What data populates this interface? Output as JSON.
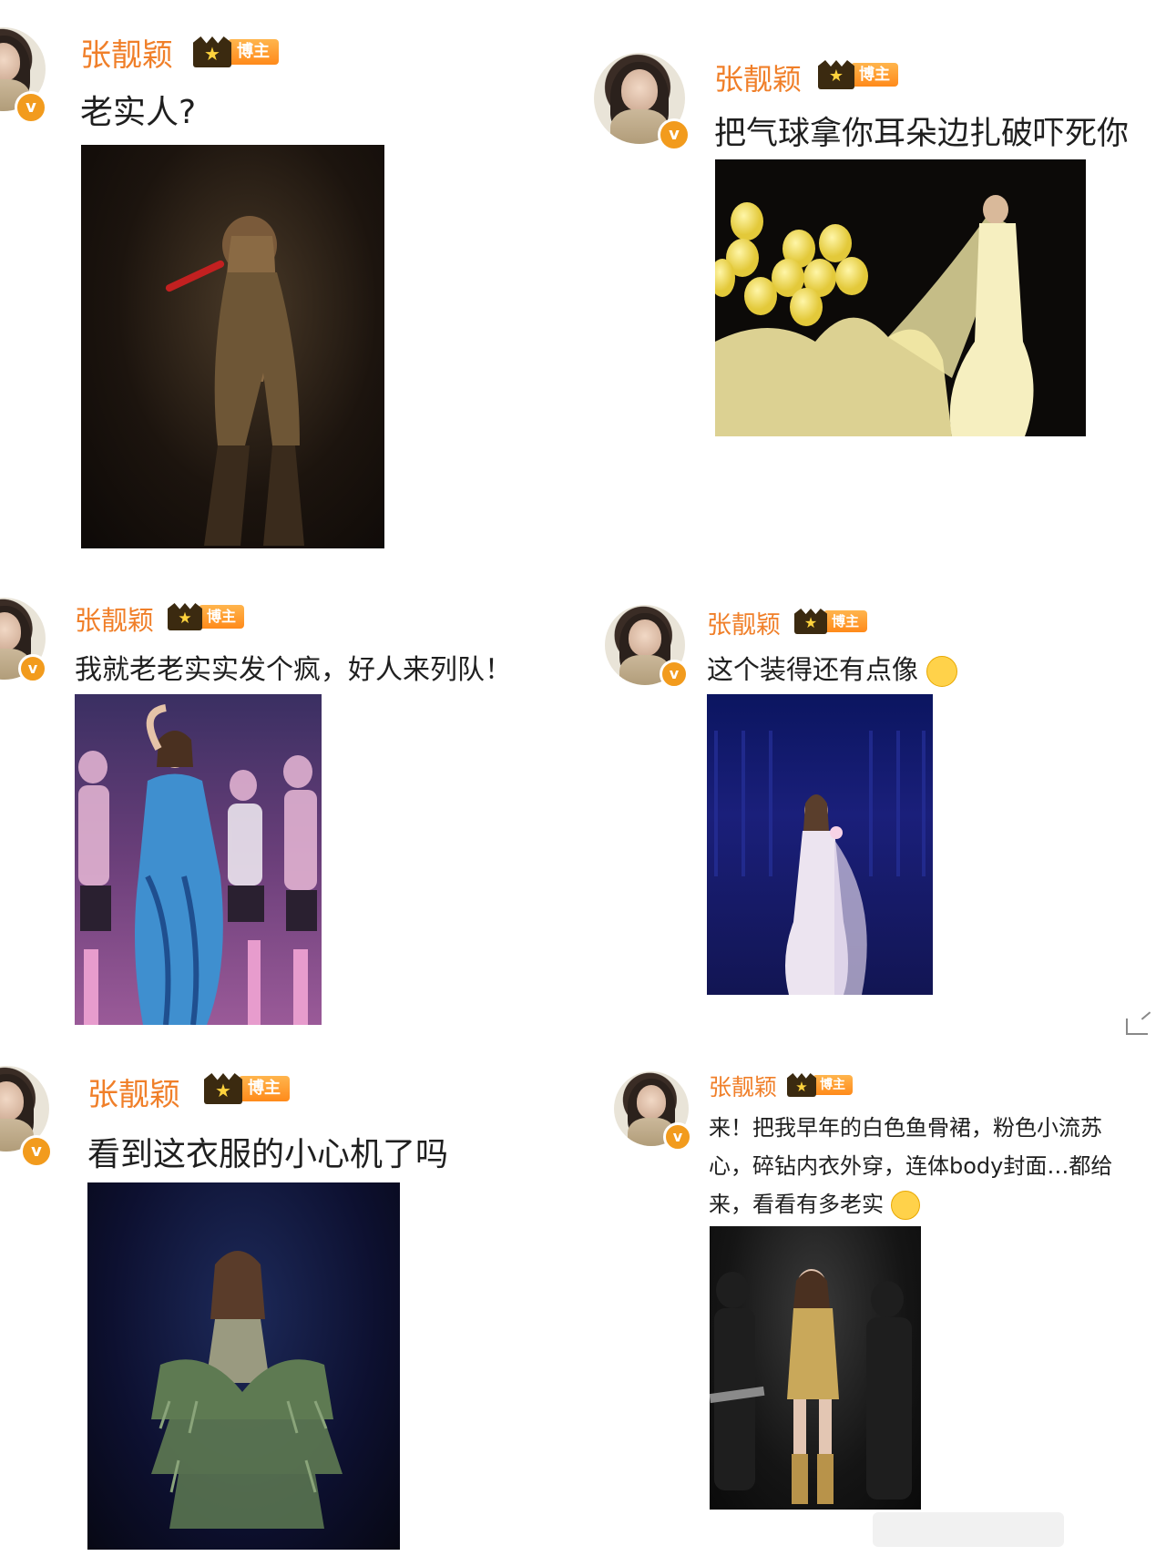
{
  "posts": [
    {
      "author": "张靓颖",
      "badge": "博主",
      "text": "老实人?"
    },
    {
      "author": "张靓颖",
      "badge": "博主",
      "text": "把气球拿你耳朵边扎破吓死你"
    },
    {
      "author": "张靓颖",
      "badge": "博主",
      "text": "我就老老实实发个疯，好人来列队！"
    },
    {
      "author": "张靓颖",
      "badge": "博主",
      "text": "这个装得还有点像",
      "emoji": "thinking-face-emoji"
    },
    {
      "author": "张靓颖",
      "badge": "博主",
      "text": "看到这衣服的小心机了吗"
    },
    {
      "author": "张靓颖",
      "badge": "博主",
      "text_lines": [
        "来！把我早年的白色鱼骨裙，粉色小流苏",
        "心，碎钻内衣外穿，连体body封面…都给",
        "来，看看有多老实"
      ],
      "emoji": "smiling-face-emoji"
    }
  ],
  "icons": {
    "verified": "verified-v-icon",
    "crown": "crown-icon",
    "expand": "expand-icon"
  },
  "colors": {
    "name": "#f07f29",
    "verified": "#f29b1d",
    "badge": "#ff8a1a"
  }
}
